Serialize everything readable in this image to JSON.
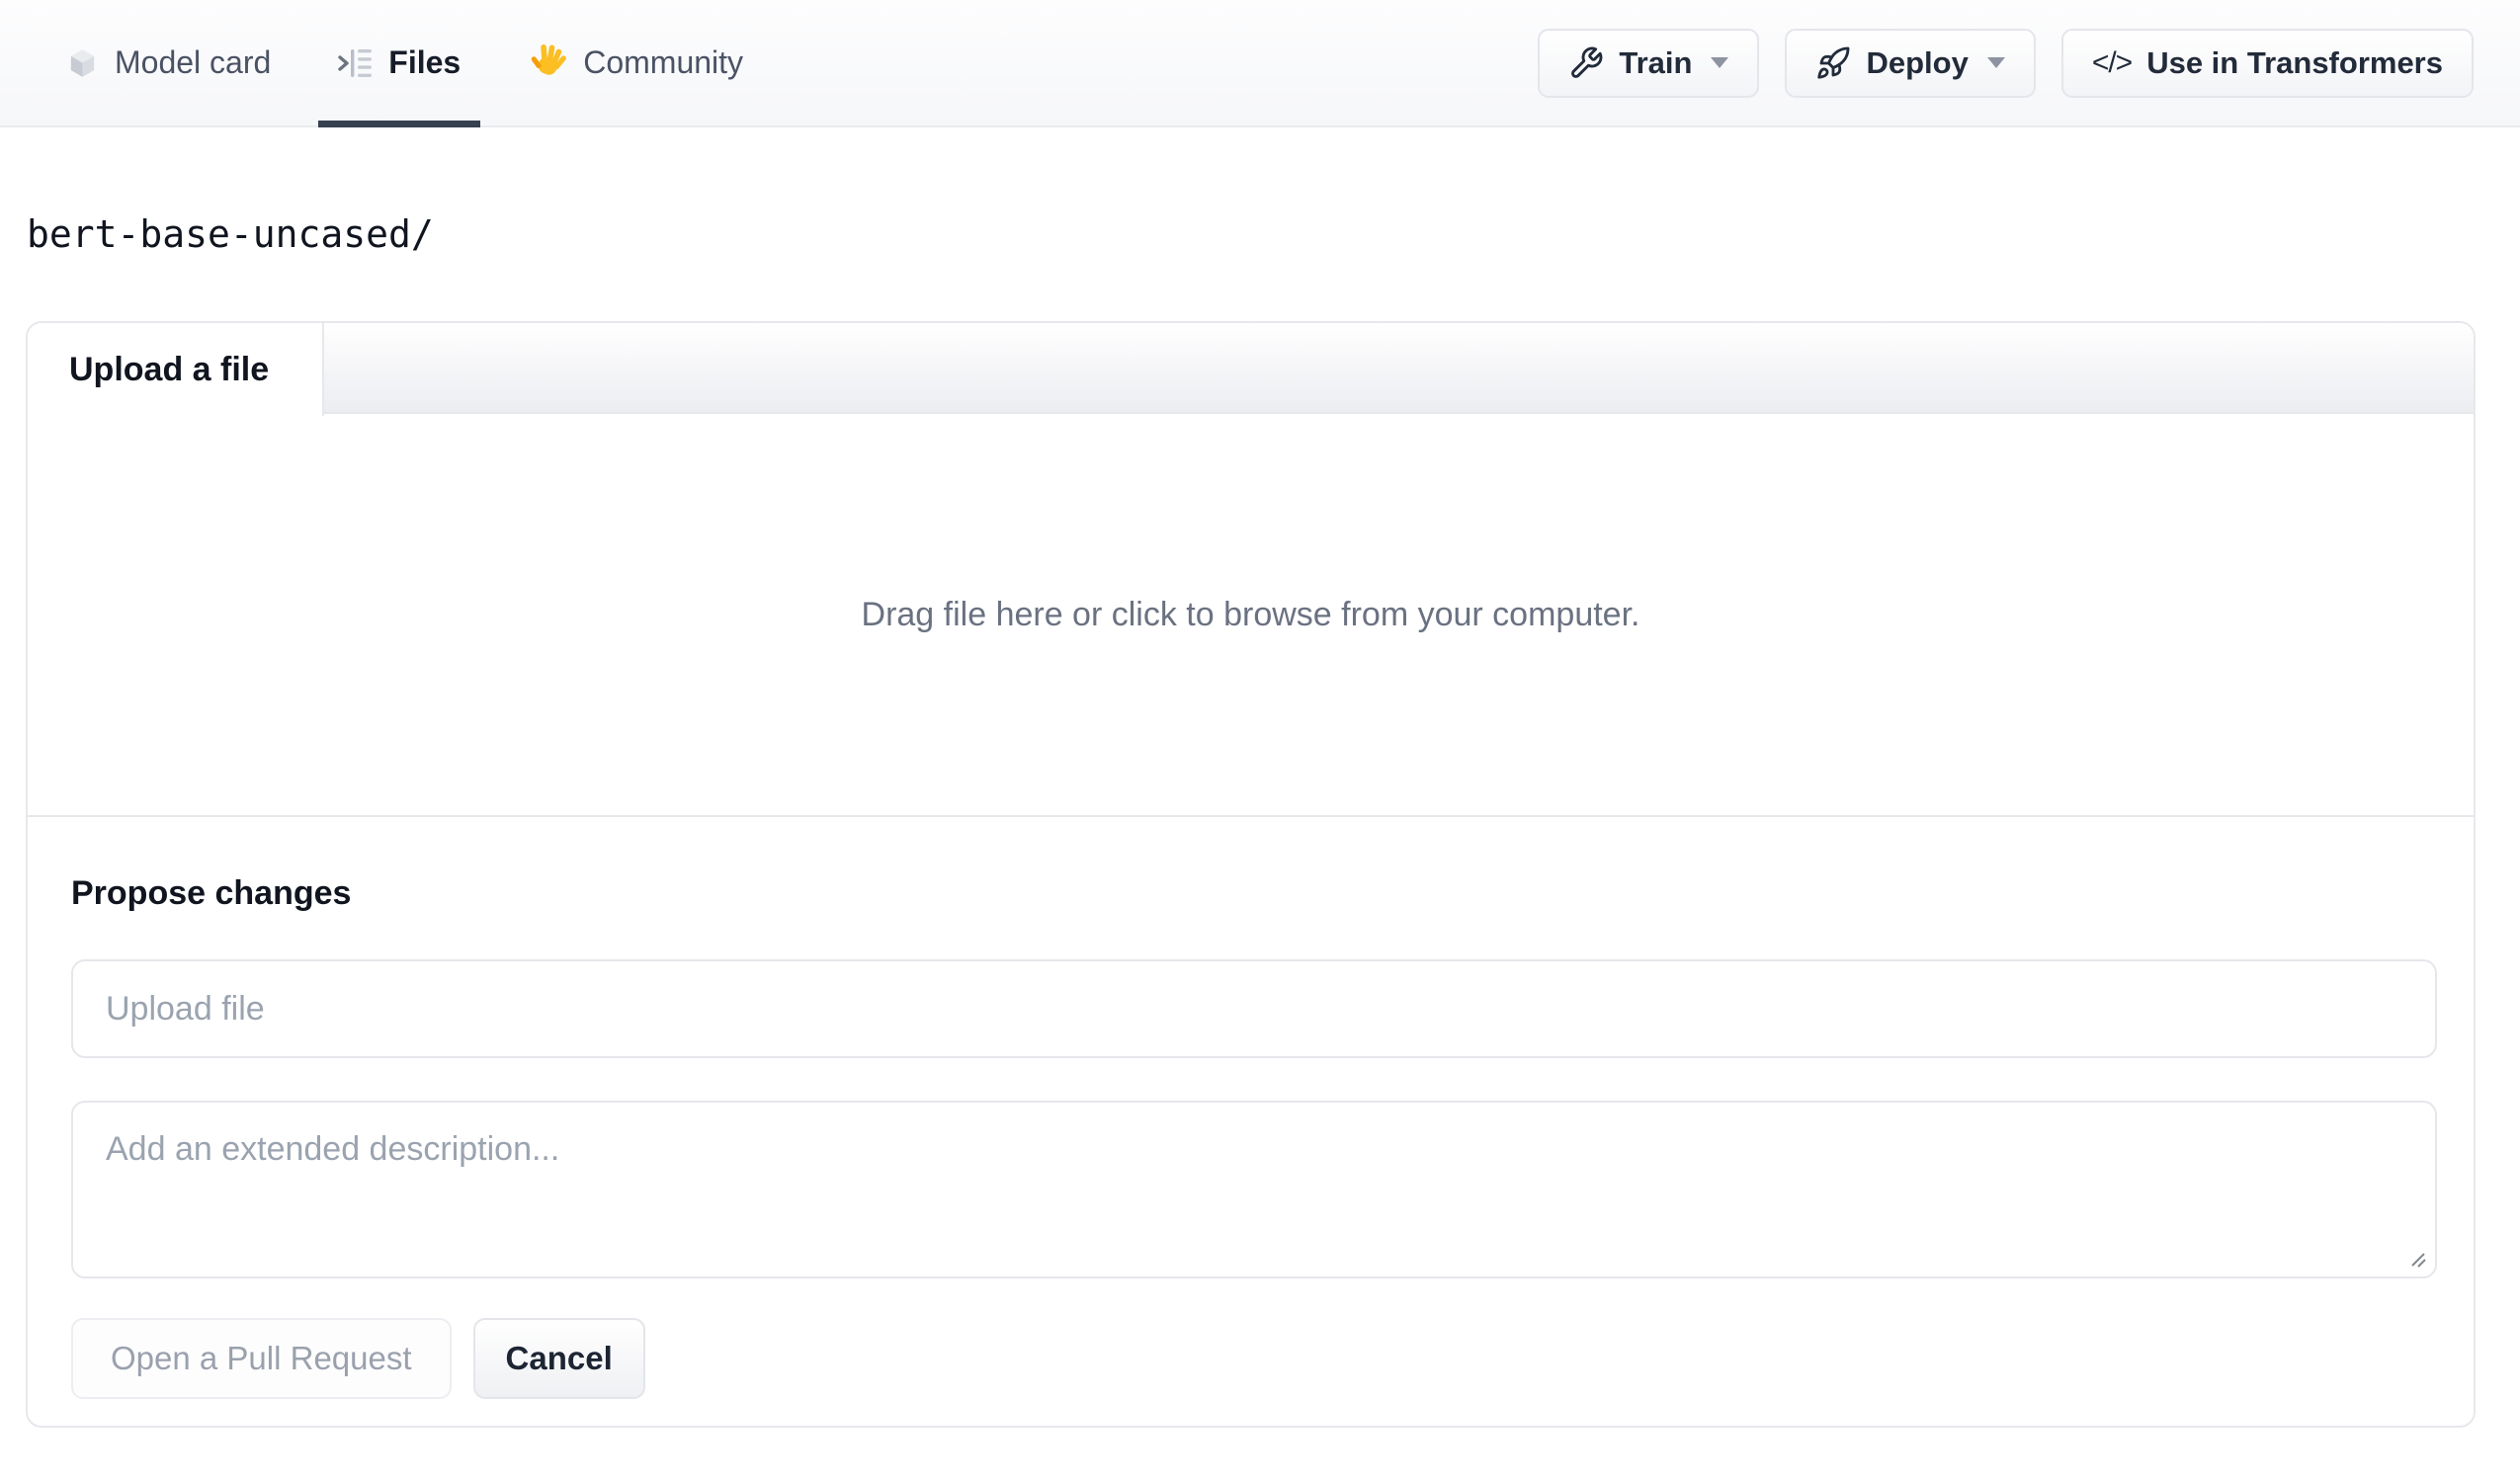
{
  "nav": {
    "tabs": [
      {
        "label": "Model card",
        "icon": "cube-icon"
      },
      {
        "label": "Files",
        "icon": "file-tree-icon",
        "active": true
      },
      {
        "label": "Community",
        "icon": "waving-hand-emoji"
      }
    ],
    "actions": [
      {
        "label": "Train",
        "icon": "wrench-icon",
        "has_dropdown": true
      },
      {
        "label": "Deploy",
        "icon": "rocket-icon",
        "has_dropdown": true
      },
      {
        "label": "Use in Transformers",
        "icon": "code-icon",
        "icon_text": "</>",
        "has_dropdown": false
      }
    ]
  },
  "breadcrumb": {
    "path": "bert-base-uncased/"
  },
  "upload_card": {
    "tab_label": "Upload a file",
    "dropzone_text": "Drag file here or click to browse from your computer.",
    "propose": {
      "heading": "Propose changes",
      "file_input_placeholder": "Upload file",
      "description_placeholder": "Add an extended description...",
      "primary_button_label": "Open a Pull Request",
      "cancel_button_label": "Cancel"
    }
  },
  "colors": {
    "nav_background": "#f8f9fb",
    "active_tab_underline": "#364050",
    "border": "#e7e8ec",
    "muted_text": "#6a7181",
    "placeholder_text": "#9aa3af",
    "emoji_yellow": "#fbbf24"
  }
}
